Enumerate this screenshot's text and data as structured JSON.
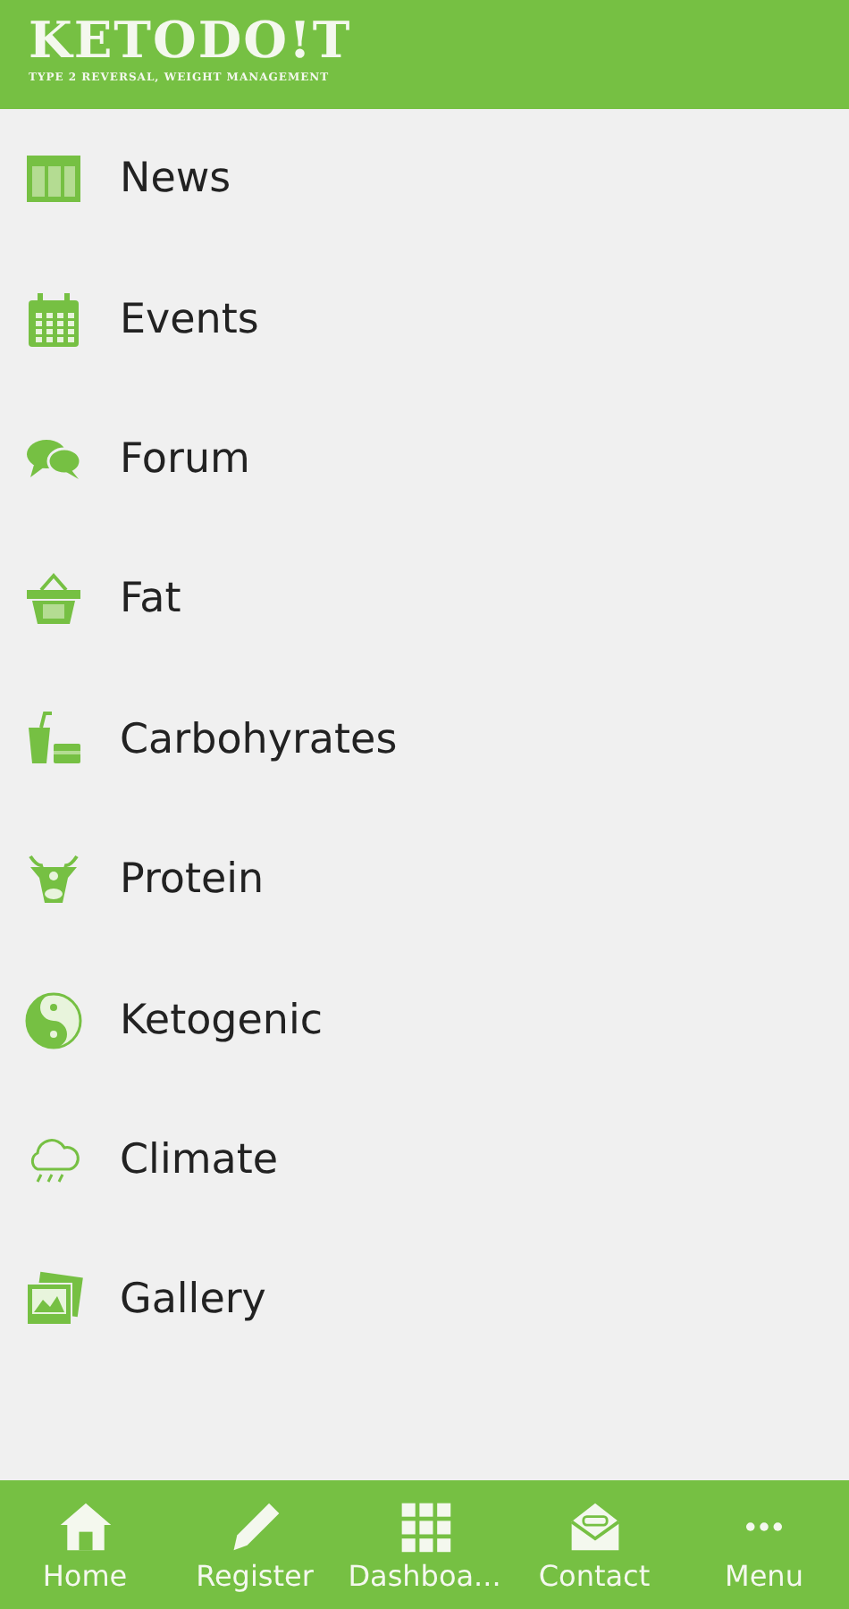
{
  "header": {
    "logo": "KETODO!T",
    "tagline": "TYPE 2 REVERSAL, WEIGHT MANAGEMENT"
  },
  "menu": [
    {
      "label": "News"
    },
    {
      "label": "Events"
    },
    {
      "label": "Forum"
    },
    {
      "label": "Fat"
    },
    {
      "label": "Carbohyrates"
    },
    {
      "label": "Protein"
    },
    {
      "label": "Ketogenic"
    },
    {
      "label": "Climate"
    },
    {
      "label": "Gallery"
    }
  ],
  "tab_bar": [
    {
      "label": "Home"
    },
    {
      "label": "Register"
    },
    {
      "label": "Dashboa..."
    },
    {
      "label": "Contact"
    },
    {
      "label": "Menu"
    }
  ]
}
